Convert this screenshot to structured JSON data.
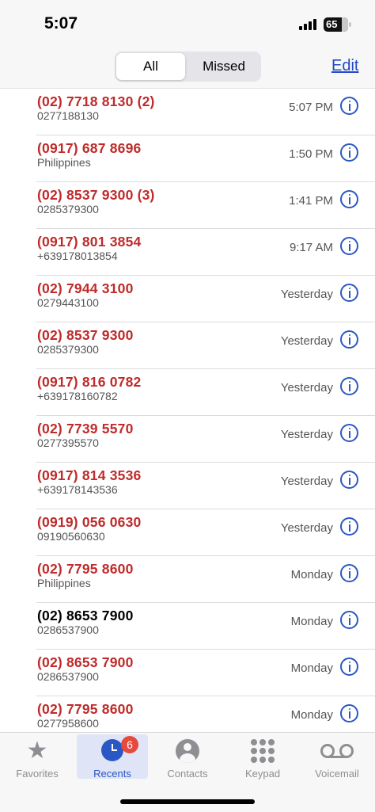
{
  "status": {
    "time": "5:07",
    "battery": "65"
  },
  "header": {
    "segments": [
      "All",
      "Missed"
    ],
    "edit_label": "Edit"
  },
  "calls": [
    {
      "number": "(02) 7718 8130 (2)",
      "detail": "0277188130",
      "time": "5:07 PM",
      "missed": true
    },
    {
      "number": "(0917) 687 8696",
      "detail": "Philippines",
      "time": "1:50 PM",
      "missed": true
    },
    {
      "number": "(02) 8537 9300 (3)",
      "detail": "0285379300",
      "time": "1:41 PM",
      "missed": true
    },
    {
      "number": "(0917) 801 3854",
      "detail": "+639178013854",
      "time": "9:17 AM",
      "missed": true
    },
    {
      "number": "(02) 7944 3100",
      "detail": "0279443100",
      "time": "Yesterday",
      "missed": true
    },
    {
      "number": "(02) 8537 9300",
      "detail": "0285379300",
      "time": "Yesterday",
      "missed": true
    },
    {
      "number": "(0917) 816 0782",
      "detail": "+639178160782",
      "time": "Yesterday",
      "missed": true
    },
    {
      "number": "(02) 7739 5570",
      "detail": "0277395570",
      "time": "Yesterday",
      "missed": true
    },
    {
      "number": "(0917) 814 3536",
      "detail": "+639178143536",
      "time": "Yesterday",
      "missed": true
    },
    {
      "number": "(0919) 056 0630",
      "detail": "09190560630",
      "time": "Yesterday",
      "missed": true
    },
    {
      "number": "(02) 7795 8600",
      "detail": "Philippines",
      "time": "Monday",
      "missed": true
    },
    {
      "number": "(02) 8653 7900",
      "detail": "0286537900",
      "time": "Monday",
      "missed": false
    },
    {
      "number": "(02) 8653 7900",
      "detail": "0286537900",
      "time": "Monday",
      "missed": true
    },
    {
      "number": "(02) 7795 8600",
      "detail": "0277958600",
      "time": "Monday",
      "missed": true
    }
  ],
  "tabbar": {
    "favorites": "Favorites",
    "recents": "Recents",
    "recents_badge": "6",
    "contacts": "Contacts",
    "keypad": "Keypad",
    "voicemail": "Voicemail"
  },
  "colors": {
    "missed": "#c02a2a",
    "accent": "#2b57c4",
    "badge": "#e64a3c"
  }
}
